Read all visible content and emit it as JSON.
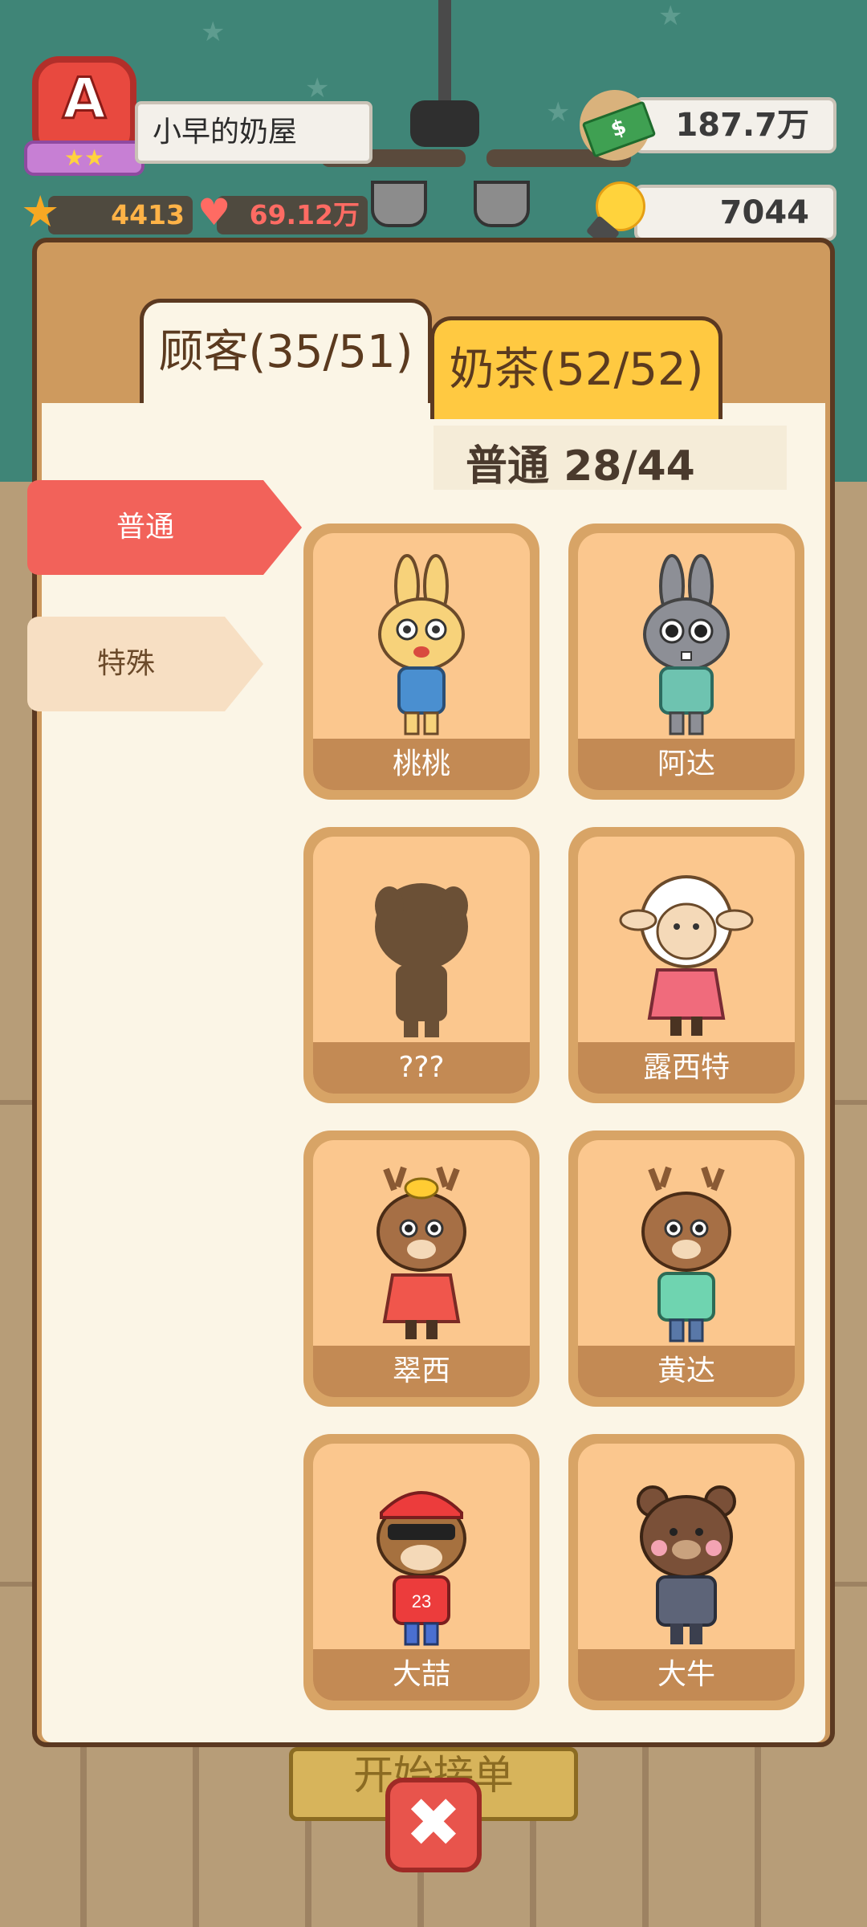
{
  "header": {
    "rank_letter": "A",
    "rank_stars": "★★",
    "shop_name": "小早的奶屋",
    "stars_count": "4413",
    "fans_count": "69.12万",
    "money": "187.7万",
    "ideas": "7044"
  },
  "tabs": [
    {
      "label": "顾客(35/51)"
    },
    {
      "label": "奶茶(52/52)"
    }
  ],
  "section_title": "普通  28/44",
  "side_tabs": [
    {
      "label": "普通"
    },
    {
      "label": "特殊"
    }
  ],
  "cards": [
    {
      "name": "桃桃",
      "icon": "rabbit-yellow-icon"
    },
    {
      "name": "阿达",
      "icon": "rabbit-grey-icon"
    },
    {
      "name": "???",
      "icon": "silhouette-locked-icon"
    },
    {
      "name": "露西特",
      "icon": "sheep-icon"
    },
    {
      "name": "翠西",
      "icon": "deer-girl-icon"
    },
    {
      "name": "黄达",
      "icon": "deer-boy-icon"
    },
    {
      "name": "大喆",
      "icon": "monkey-cap-icon"
    },
    {
      "name": "大牛",
      "icon": "bear-suit-icon"
    }
  ],
  "close_label": "✖",
  "start_label": "开始接单",
  "colors": {
    "panel": "#ce9a5e",
    "panel_border": "#5b3921",
    "active_side_tab": "#f2625a",
    "tab_inactive": "#ffc941",
    "card_bg": "#fbc78e",
    "card_label_bg": "#c38a54"
  }
}
